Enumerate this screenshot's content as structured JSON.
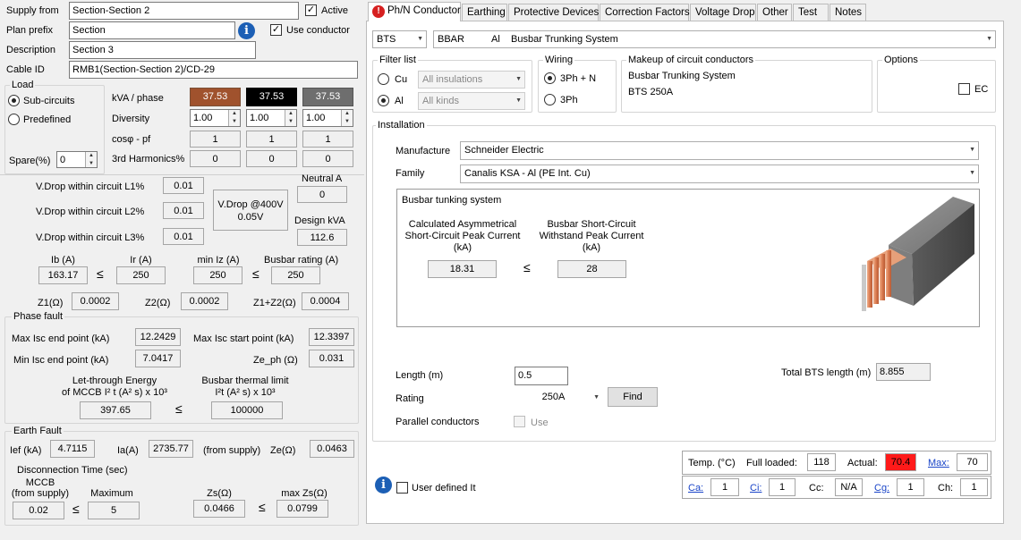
{
  "header": {
    "supply_from_label": "Supply from",
    "supply_from_value": "Section-Section 2",
    "active_label": "Active",
    "active_checked": true,
    "plan_prefix_label": "Plan prefix",
    "plan_prefix_value": "Section",
    "use_conductor_label": "Use conductor",
    "use_conductor_checked": true,
    "description_label": "Description",
    "description_value": "Section 3",
    "cable_id_label": "Cable ID",
    "cable_id_value": "RMB1(Section-Section 2)/CD-29"
  },
  "load": {
    "title": "Load",
    "subcircuits_label": "Sub-circuits",
    "predefined_label": "Predefined",
    "spare_label": "Spare(%)",
    "spare_value": "0",
    "kva_label": "kVA / phase",
    "kva_values": [
      "37.53",
      "37.53",
      "37.53"
    ],
    "phase_colors": [
      "#a0522d",
      "#000000",
      "#6e6e6e"
    ],
    "diversity_label": "Diversity",
    "diversity_values": [
      "1.00",
      "1.00",
      "1.00"
    ],
    "cos_label": "cosφ - pf",
    "cos_values": [
      "1",
      "1",
      "1"
    ],
    "harmonics_label": "3rd Harmonics%",
    "harmonics_values": [
      "0",
      "0",
      "0"
    ]
  },
  "vdrop": {
    "l1_label": "V.Drop within circuit L1%",
    "l1_value": "0.01",
    "l2_label": "V.Drop within circuit L2%",
    "l2_value": "0.01",
    "l3_label": "V.Drop within circuit L3%",
    "l3_value": "0.01",
    "at400_label": "V.Drop @400V",
    "at400_value": "0.05V",
    "neutral_label": "Neutral A",
    "neutral_value": "0",
    "design_kva_label": "Design kVA",
    "design_kva_value": "112.6"
  },
  "currents": {
    "ib_label": "Ib (A)",
    "ib_value": "163.17",
    "ir_label": "Ir (A)",
    "ir_value": "250",
    "miniz_label": "min Iz (A)",
    "miniz_value": "250",
    "busbar_label": "Busbar rating (A)",
    "busbar_value": "250",
    "leq": "≤",
    "z1_label": "Z1(Ω)",
    "z1_value": "0.0002",
    "z2_label": "Z2(Ω)",
    "z2_value": "0.0002",
    "z12_label": "Z1+Z2(Ω)",
    "z12_value": "0.0004"
  },
  "phase_fault": {
    "title": "Phase fault",
    "max_end_label": "Max Isc end point (kA)",
    "max_end_value": "12.2429",
    "max_start_label": "Max Isc start point (kA)",
    "max_start_value": "12.3397",
    "min_end_label": "Min Isc end point (kA)",
    "min_end_value": "7.0417",
    "zeph_label": "Ze_ph (Ω)",
    "zeph_value": "0.031",
    "letthrough_line1": "Let-through Energy",
    "letthrough_line2": "of MCCB I² t (A² s)  x 10³",
    "letthrough_value": "397.65",
    "thermal_line1": "Busbar thermal limit",
    "thermal_line2": "I²t (A² s)  x 10³",
    "thermal_value": "100000"
  },
  "earth_fault": {
    "title": "Earth Fault",
    "ief_label": "Ief (kA)",
    "ief_value": "4.7115",
    "ia_label": "Ia(A)",
    "ia_value": "2735.77",
    "from_supply_label": "(from supply)",
    "ze_label": "Ze(Ω)",
    "ze_value": "0.0463",
    "disconnection_label": "Disconnection Time (sec)",
    "mccb_line1": "MCCB",
    "mccb_line2": "(from supply)",
    "mccb_value": "0.02",
    "maximum_label": "Maximum",
    "maximum_value": "5",
    "zs_label": "Zs(Ω)",
    "zs_value": "0.0466",
    "maxzs_label": "max Zs(Ω)",
    "maxzs_value": "0.0799"
  },
  "tabs": [
    "Ph/N Conductor",
    "Earthing",
    "Protective Devices",
    "Correction Factors",
    "Voltage Drop",
    "Other",
    "Test",
    "Notes"
  ],
  "conductor": {
    "type_value": "BTS",
    "code_value": "BBAR",
    "material_value": "Al",
    "system_value": "Busbar Trunking System"
  },
  "filter": {
    "title": "Filter list",
    "cu_label": "Cu",
    "al_label": "Al",
    "insulation_placeholder": "All insulations",
    "kinds_placeholder": "All kinds"
  },
  "wiring": {
    "title": "Wiring",
    "opt1_label": "3Ph + N",
    "opt2_label": "3Ph"
  },
  "makeup": {
    "title": "Makeup of circuit conductors",
    "line1": "Busbar Trunking System",
    "line2": "BTS 250A"
  },
  "options": {
    "title": "Options",
    "ec_label": "EC"
  },
  "installation": {
    "title": "Installation",
    "manufacture_label": "Manufacture",
    "manufacture_value": "Schneider Electric",
    "family_label": "Family",
    "family_value": "Canalis KSA - Al (PE Int. Cu)",
    "panel_title": "Busbar tunking system",
    "calc_line1": "Calculated Asymmetrical",
    "calc_line2": "Short-Circuit Peak Current",
    "calc_line3": "(kA)",
    "calc_value": "18.31",
    "withstand_line1": "Busbar Short-Circuit",
    "withstand_line2": "Withstand Peak Current",
    "withstand_line3": "(kA)",
    "withstand_value": "28",
    "length_label": "Length (m)",
    "length_value": "0.5",
    "total_label": "Total BTS length (m)",
    "total_value": "8.855",
    "rating_label": "Rating",
    "rating_value": "250A",
    "find_label": "Find",
    "parallel_label": "Parallel conductors",
    "use_label": "Use"
  },
  "temperature": {
    "label": "Temp. (°C)",
    "full_loaded_label": "Full loaded:",
    "full_loaded_value": "118",
    "actual_label": "Actual:",
    "actual_value": "70.4",
    "actual_color": "#ff1a1a",
    "max_label": "Max:",
    "max_value": "70"
  },
  "factors": {
    "ca_label": "Ca:",
    "ca_value": "1",
    "ci_label": "Ci:",
    "ci_value": "1",
    "cc_label": "Cc:",
    "cc_value": "N/A",
    "cg_label": "Cg:",
    "cg_value": "1",
    "ch_label": "Ch:",
    "ch_value": "1"
  },
  "user_defined_label": "User defined It"
}
